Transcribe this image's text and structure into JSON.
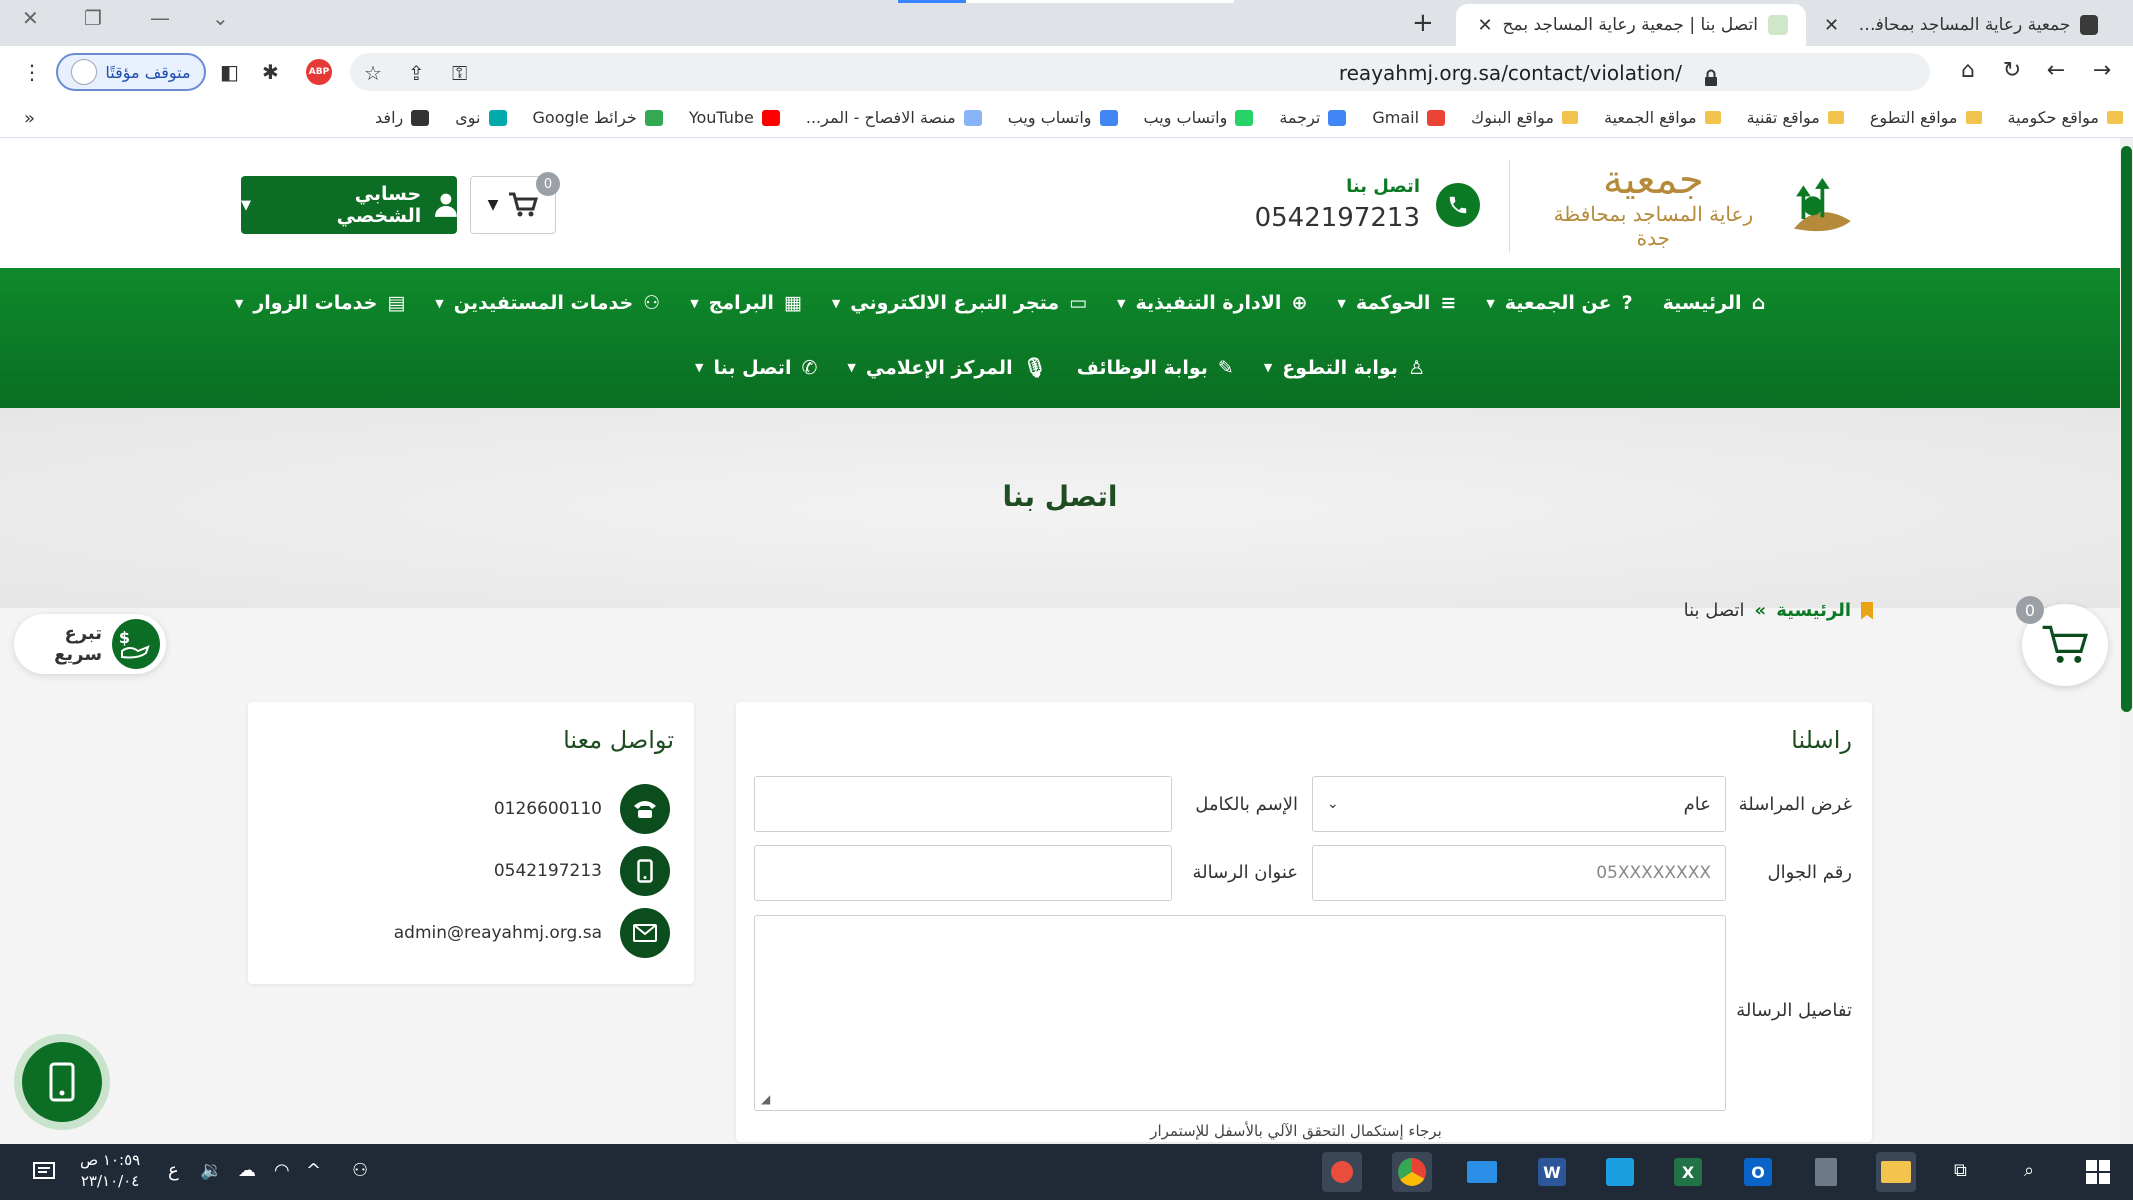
{
  "browser": {
    "tabs": [
      {
        "title": "جمعية رعاية المساجد بمحافظة جدة",
        "active": false
      },
      {
        "title": "اتصل بنا | جمعية رعاية المساجد بمح",
        "active": true
      }
    ],
    "url": "reayahmj.org.sa/contact/violation/",
    "paused_label": "متوقف مؤقتًا",
    "bookmarks": [
      {
        "label": "مواقع حكومية",
        "type": "folder"
      },
      {
        "label": "مواقع التطوع",
        "type": "folder"
      },
      {
        "label": "مواقع تقنية",
        "type": "folder"
      },
      {
        "label": "مواقع الجمعية",
        "type": "folder"
      },
      {
        "label": "مواقع البنوك",
        "type": "folder"
      },
      {
        "label": "Gmail",
        "type": "gmail"
      },
      {
        "label": "ترجمة",
        "type": "translate"
      },
      {
        "label": "واتساب ويب",
        "type": "whatsapp"
      },
      {
        "label": "واتساب ويب",
        "type": "google"
      },
      {
        "label": "منصة الافصاح - المر...",
        "type": "doc"
      },
      {
        "label": "YouTube",
        "type": "youtube"
      },
      {
        "label": "خرائط Google",
        "type": "maps"
      },
      {
        "label": "نوى",
        "type": "nawa"
      },
      {
        "label": "رافد",
        "type": "rafid"
      }
    ],
    "bookmarks_more": "»"
  },
  "header": {
    "logo_line1": "جمعية",
    "logo_line2": "رعاية المساجد بمحافظة جدة",
    "call_label": "اتصل بنا",
    "call_number": "0542197213",
    "cart_count": "0",
    "account_label": "حسابي الشخصي"
  },
  "nav": {
    "row1": [
      {
        "label": "الرئيسية",
        "icon": "home-icon",
        "dropdown": false
      },
      {
        "label": "عن الجمعية",
        "icon": "question-icon",
        "dropdown": true
      },
      {
        "label": "الحوكمة",
        "icon": "list-icon",
        "dropdown": true
      },
      {
        "label": "الادارة التنفيذية",
        "icon": "plus-circle-icon",
        "dropdown": true
      },
      {
        "label": "متجر التبرع الالكتروني",
        "icon": "card-icon",
        "dropdown": true
      },
      {
        "label": "البرامج",
        "icon": "calendar-icon",
        "dropdown": true
      },
      {
        "label": "خدمات المستفيدين",
        "icon": "users-icon",
        "dropdown": true
      },
      {
        "label": "خدمات الزوار",
        "icon": "table-icon",
        "dropdown": true
      }
    ],
    "row2": [
      {
        "label": "بوابة التطوع",
        "icon": "shirt-icon",
        "dropdown": true
      },
      {
        "label": "بوابة الوظائف",
        "icon": "edit-icon",
        "dropdown": false
      },
      {
        "label": "المركز الإعلامي",
        "icon": "mic-icon",
        "dropdown": true
      },
      {
        "label": "اتصل بنا",
        "icon": "phone-icon",
        "dropdown": true
      }
    ]
  },
  "page": {
    "title": "اتصل بنا",
    "breadcrumb_home": "الرئيسية",
    "breadcrumb_sep": "»",
    "breadcrumb_current": "اتصل بنا",
    "float_cart_count": "0",
    "quick_donate": "تبرع سريع"
  },
  "form": {
    "title": "راسلنا",
    "purpose_label": "غرض المراسلة",
    "purpose_value": "عام",
    "name_label": "الإسم بالكامل",
    "name_value": "",
    "mobile_label": "رقم الجوال",
    "mobile_placeholder": "05XXXXXXXX",
    "subject_label": "عنوان الرسالة",
    "subject_value": "",
    "details_label": "تفاصيل الرسالة",
    "details_value": "",
    "captcha_note": "برجاء إستكمال التحقق الآلي بالأسفل للإستمرار"
  },
  "contact": {
    "title": "تواصل معنا",
    "phone": "0126600110",
    "mobile": "0542197213",
    "email": "admin@reayahmj.org.sa"
  },
  "taskbar": {
    "time": "١٠:٥٩ ص",
    "date": "٢٣/١٠/٠٤",
    "lang": "ع"
  },
  "colors": {
    "brand_green": "#0c6e24",
    "nav_green": "#0f8a2b",
    "dark_green": "#0c4d1e",
    "gold": "#b58a3a"
  }
}
